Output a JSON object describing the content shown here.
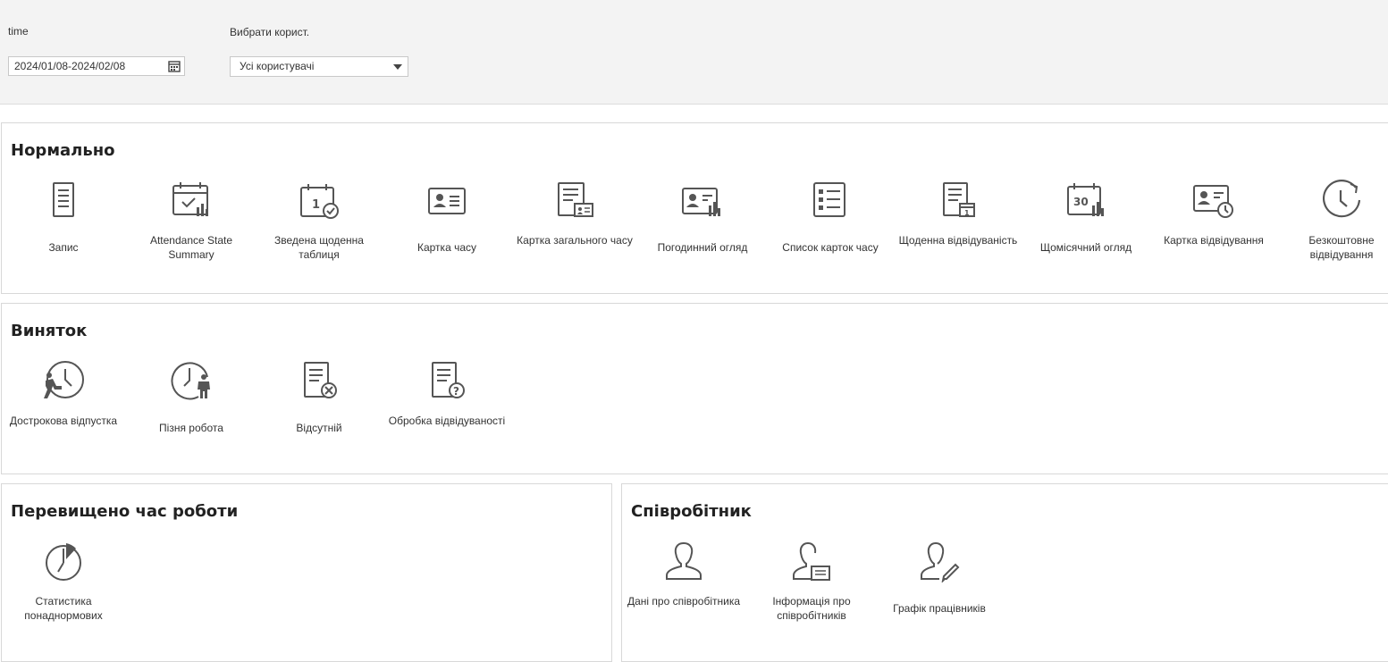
{
  "filters": {
    "time_label": "time",
    "time_value": "2024/01/08-2024/02/08",
    "user_label": "Вибрати корист.",
    "user_value": "Усі користувачі"
  },
  "sections": {
    "normal": {
      "title": "Нормально",
      "items": [
        {
          "label": "Запис"
        },
        {
          "label": "Attendance State Summary"
        },
        {
          "label": "Зведена щоденна таблиця"
        },
        {
          "label": "Картка часу"
        },
        {
          "label": "Картка загального часу"
        },
        {
          "label": "Погодинний огляд"
        },
        {
          "label": "Список карток часу"
        },
        {
          "label": "Щоденна відвідуваність"
        },
        {
          "label": "Щомісячний огляд",
          "icon_text": "30"
        },
        {
          "label": "Картка відвідування"
        },
        {
          "label": "Безкоштовне відвідування"
        }
      ]
    },
    "exception": {
      "title": "Виняток",
      "items": [
        {
          "label": "Дострокова відпустка"
        },
        {
          "label": "Пізня робота"
        },
        {
          "label": "Відсутній"
        },
        {
          "label": "Обробка відвідуваності"
        }
      ]
    },
    "overtime": {
      "title": "Перевищено час роботи",
      "items": [
        {
          "label": "Статистика понаднормових"
        }
      ]
    },
    "employee": {
      "title": "Співробітник",
      "items": [
        {
          "label": "Дані про співробітника"
        },
        {
          "label": "Інформація про співробітників"
        },
        {
          "label": "Графік працівників"
        }
      ]
    }
  },
  "icons": {
    "normal": [
      "document-list-icon",
      "calendar-check-chart-icon",
      "calendar-one-check-icon",
      "id-card-icon",
      "document-id-card-icon",
      "id-card-chart-icon",
      "checklist-icon",
      "document-calendar-icon",
      "calendar-thirty-chart-icon",
      "id-card-clock-icon",
      "clock-arrow-icon"
    ],
    "exception": [
      "clock-running-person-icon",
      "clock-person-icon",
      "document-x-icon",
      "document-question-icon"
    ],
    "overtime": [
      "pie-clock-icon"
    ],
    "employee": [
      "user-icon",
      "user-card-icon",
      "user-pen-icon"
    ]
  },
  "colors": {
    "icon": "#555555",
    "panel_bg": "#f3f3f3",
    "border": "#d8d8d8"
  }
}
